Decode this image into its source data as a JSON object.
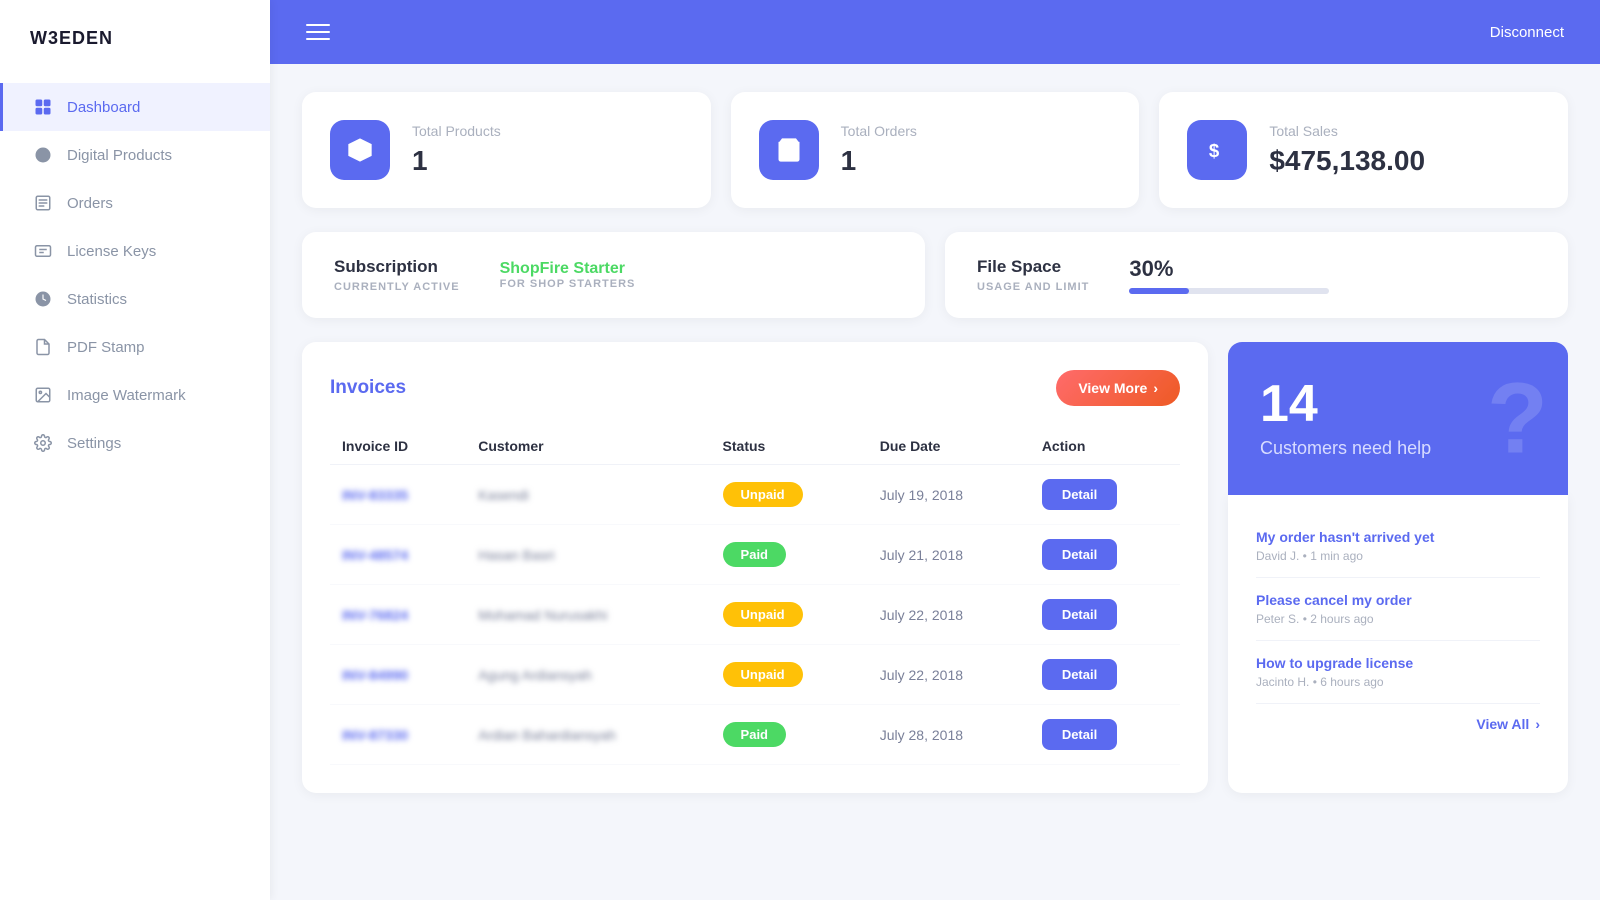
{
  "app": {
    "name": "W3EDEN",
    "disconnect_label": "Disconnect"
  },
  "sidebar": {
    "items": [
      {
        "id": "dashboard",
        "label": "Dashboard",
        "icon": "dashboard-icon",
        "active": true
      },
      {
        "id": "digital-products",
        "label": "Digital Products",
        "icon": "digital-products-icon",
        "active": false
      },
      {
        "id": "orders",
        "label": "Orders",
        "icon": "orders-icon",
        "active": false
      },
      {
        "id": "license-keys",
        "label": "License Keys",
        "icon": "license-keys-icon",
        "active": false
      },
      {
        "id": "statistics",
        "label": "Statistics",
        "icon": "statistics-icon",
        "active": false
      },
      {
        "id": "pdf-stamp",
        "label": "PDF Stamp",
        "icon": "pdf-stamp-icon",
        "active": false
      },
      {
        "id": "image-watermark",
        "label": "Image Watermark",
        "icon": "image-watermark-icon",
        "active": false
      },
      {
        "id": "settings",
        "label": "Settings",
        "icon": "settings-icon",
        "active": false
      }
    ]
  },
  "stats": {
    "total_products": {
      "label": "Total Products",
      "value": "1"
    },
    "total_orders": {
      "label": "Total Orders",
      "value": "1"
    },
    "total_sales": {
      "label": "Total Sales",
      "value": "$475,138.00"
    }
  },
  "subscription": {
    "title": "Subscription",
    "subtitle": "CURRENTLY ACTIVE",
    "value": "ShopFire Starter",
    "value_for": "FOR SHOP STARTERS"
  },
  "filespace": {
    "title": "File Space",
    "subtitle": "USAGE AND LIMIT",
    "percent": "30%",
    "fill": 30
  },
  "invoices": {
    "title": "Invoices",
    "view_more": "View More",
    "columns": [
      "Invoice ID",
      "Customer",
      "Status",
      "Due Date",
      "Action"
    ],
    "rows": [
      {
        "id": "INV-83335",
        "customer": "Kasendi",
        "status": "Unpaid",
        "due_date": "July 19, 2018"
      },
      {
        "id": "INV-48574",
        "customer": "Hasan Basri",
        "status": "Paid",
        "due_date": "July 21, 2018"
      },
      {
        "id": "INV-76824",
        "customer": "Mohamad Nurusakhi",
        "status": "Unpaid",
        "due_date": "July 22, 2018"
      },
      {
        "id": "INV-84990",
        "customer": "Agung Ardiansyah",
        "status": "Unpaid",
        "due_date": "July 22, 2018"
      },
      {
        "id": "INV-87330",
        "customer": "Ardian Bahardiansyah",
        "status": "Paid",
        "due_date": "July 28, 2018"
      }
    ],
    "detail_label": "Detail"
  },
  "help": {
    "count": "14",
    "text": "Customers need help",
    "support_tickets": [
      {
        "title": "My order hasn't arrived yet",
        "meta": "David J. • 1 min ago"
      },
      {
        "title": "Please cancel my order",
        "meta": "Peter S. • 2 hours ago"
      },
      {
        "title": "How to upgrade license",
        "meta": "Jacinto H. • 6 hours ago"
      }
    ],
    "view_all": "View All"
  }
}
